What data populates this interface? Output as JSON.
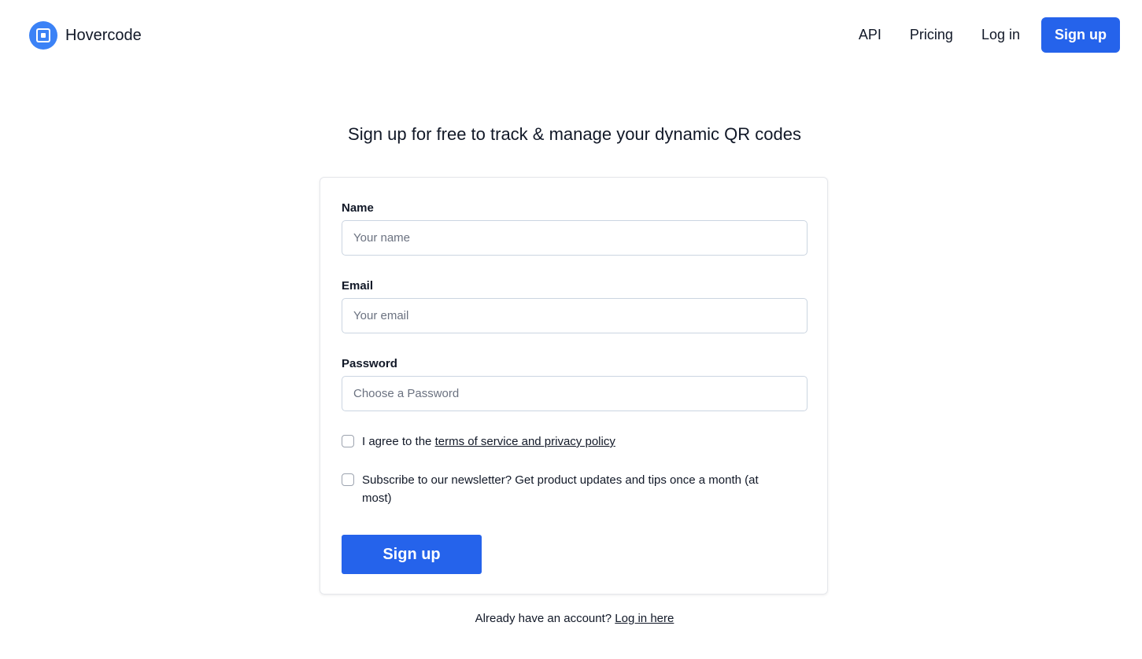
{
  "nav": {
    "brand": "Hovercode",
    "links": [
      "API",
      "Pricing",
      "Log in"
    ],
    "signup_label": "Sign up",
    "accent_color": "#2563eb"
  },
  "headline": "Sign up for free to track & manage your dynamic QR codes",
  "form": {
    "name": {
      "label": "Name",
      "placeholder": "Your name",
      "value": ""
    },
    "email": {
      "label": "Email",
      "placeholder": "Your email",
      "value": ""
    },
    "password": {
      "label": "Password",
      "placeholder": "Choose a Password",
      "value": ""
    },
    "terms": {
      "prefix": "I agree to the ",
      "link": "terms of service and privacy policy",
      "checked": false
    },
    "newsletter": {
      "label": "Subscribe to our newsletter? Get product updates and tips once a month (at most)",
      "checked": false
    },
    "submit_label": "Sign up"
  },
  "footer": {
    "prefix": "Already have an account? ",
    "link": "Log in here"
  }
}
